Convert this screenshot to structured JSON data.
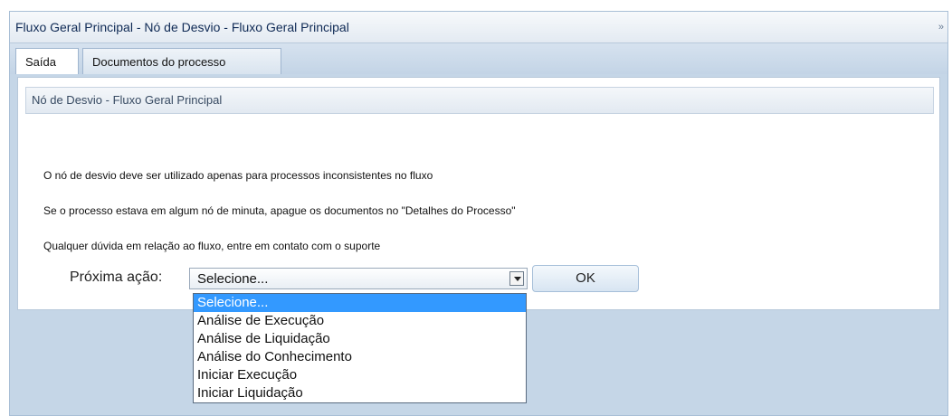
{
  "panel": {
    "title": "Fluxo Geral Principal - Nó de Desvio - Fluxo Geral Principal",
    "collapse_icon": "»"
  },
  "tabs": [
    {
      "label": "Saída",
      "active": true
    },
    {
      "label": "Documentos do processo",
      "active": false
    }
  ],
  "section": {
    "title": "Nó de Desvio - Fluxo Geral Principal"
  },
  "messages": [
    "O nó de desvio deve ser utilizado apenas para processos inconsistentes no fluxo",
    "Se o processo estava em algum nó de minuta, apague os documentos no \"Detalhes do Processo\"",
    "Qualquer dúvida em relação ao fluxo, entre em contato com o suporte"
  ],
  "action": {
    "label": "Próxima ação:",
    "selected_value": "Selecione...",
    "ok_label": "OK",
    "options": [
      "Selecione...",
      "Análise de Execução",
      "Análise de Liquidação",
      "Análise do Conhecimento",
      "Iniciar Execução",
      "Iniciar Liquidação"
    ],
    "highlighted_option": "Selecione..."
  },
  "colors": {
    "panel_bg": "#c5d6e7",
    "title_text": "#0f2a55",
    "highlight": "#3399ff"
  }
}
